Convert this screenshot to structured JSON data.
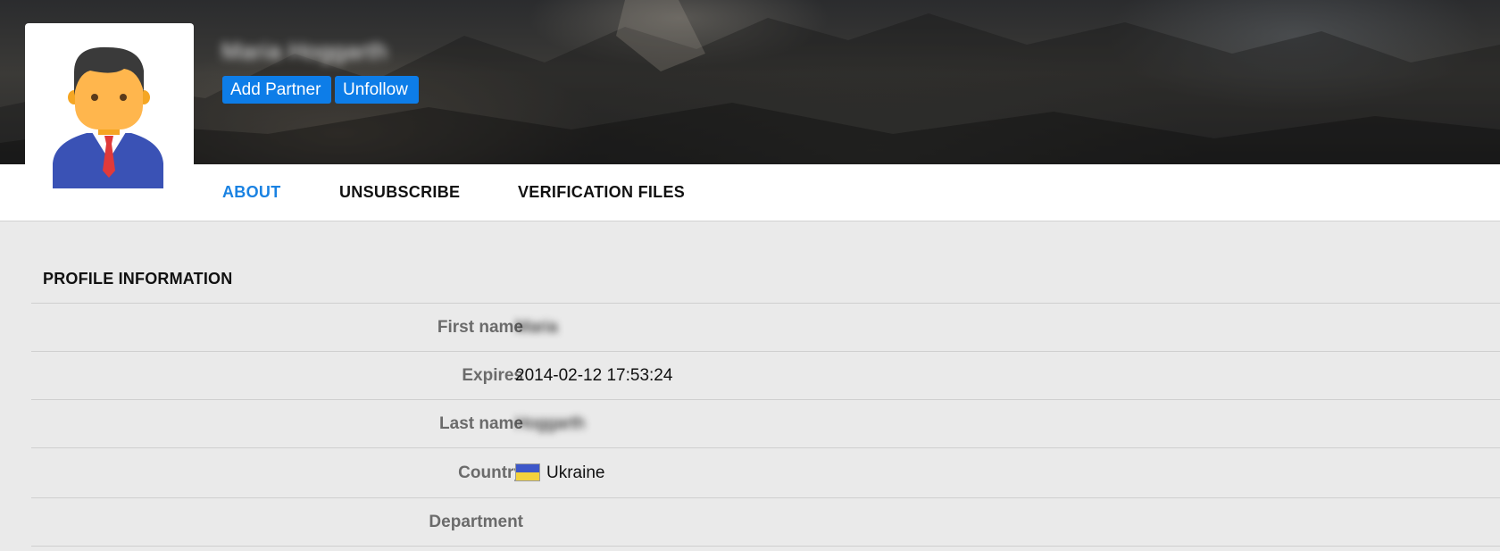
{
  "profile": {
    "name": "Maria Hoggarth",
    "avatar_icon": "businessman-avatar-icon"
  },
  "actions": {
    "add_partner_label": "Add Partner",
    "unfollow_label": "Unfollow"
  },
  "tabs": [
    {
      "label": "ABOUT",
      "active": true
    },
    {
      "label": "UNSUBSCRIBE",
      "active": false
    },
    {
      "label": "VERIFICATION FILES",
      "active": false
    }
  ],
  "section": {
    "title": "PROFILE INFORMATION"
  },
  "fields": [
    {
      "label": "First name",
      "value": "Maria",
      "blurred": true
    },
    {
      "label": "Expires",
      "value": "2014-02-12 17:53:24",
      "blurred": false
    },
    {
      "label": "Last name",
      "value": "Hoggarth",
      "blurred": true
    },
    {
      "label": "Country",
      "value": "Ukraine",
      "flag": "ukraine-flag-icon",
      "blurred": false
    },
    {
      "label": "Department",
      "value": "",
      "blurred": false
    }
  ],
  "colors": {
    "accent": "#0d7de8",
    "active_tab": "#1a82e2",
    "background": "#eaeaea"
  }
}
